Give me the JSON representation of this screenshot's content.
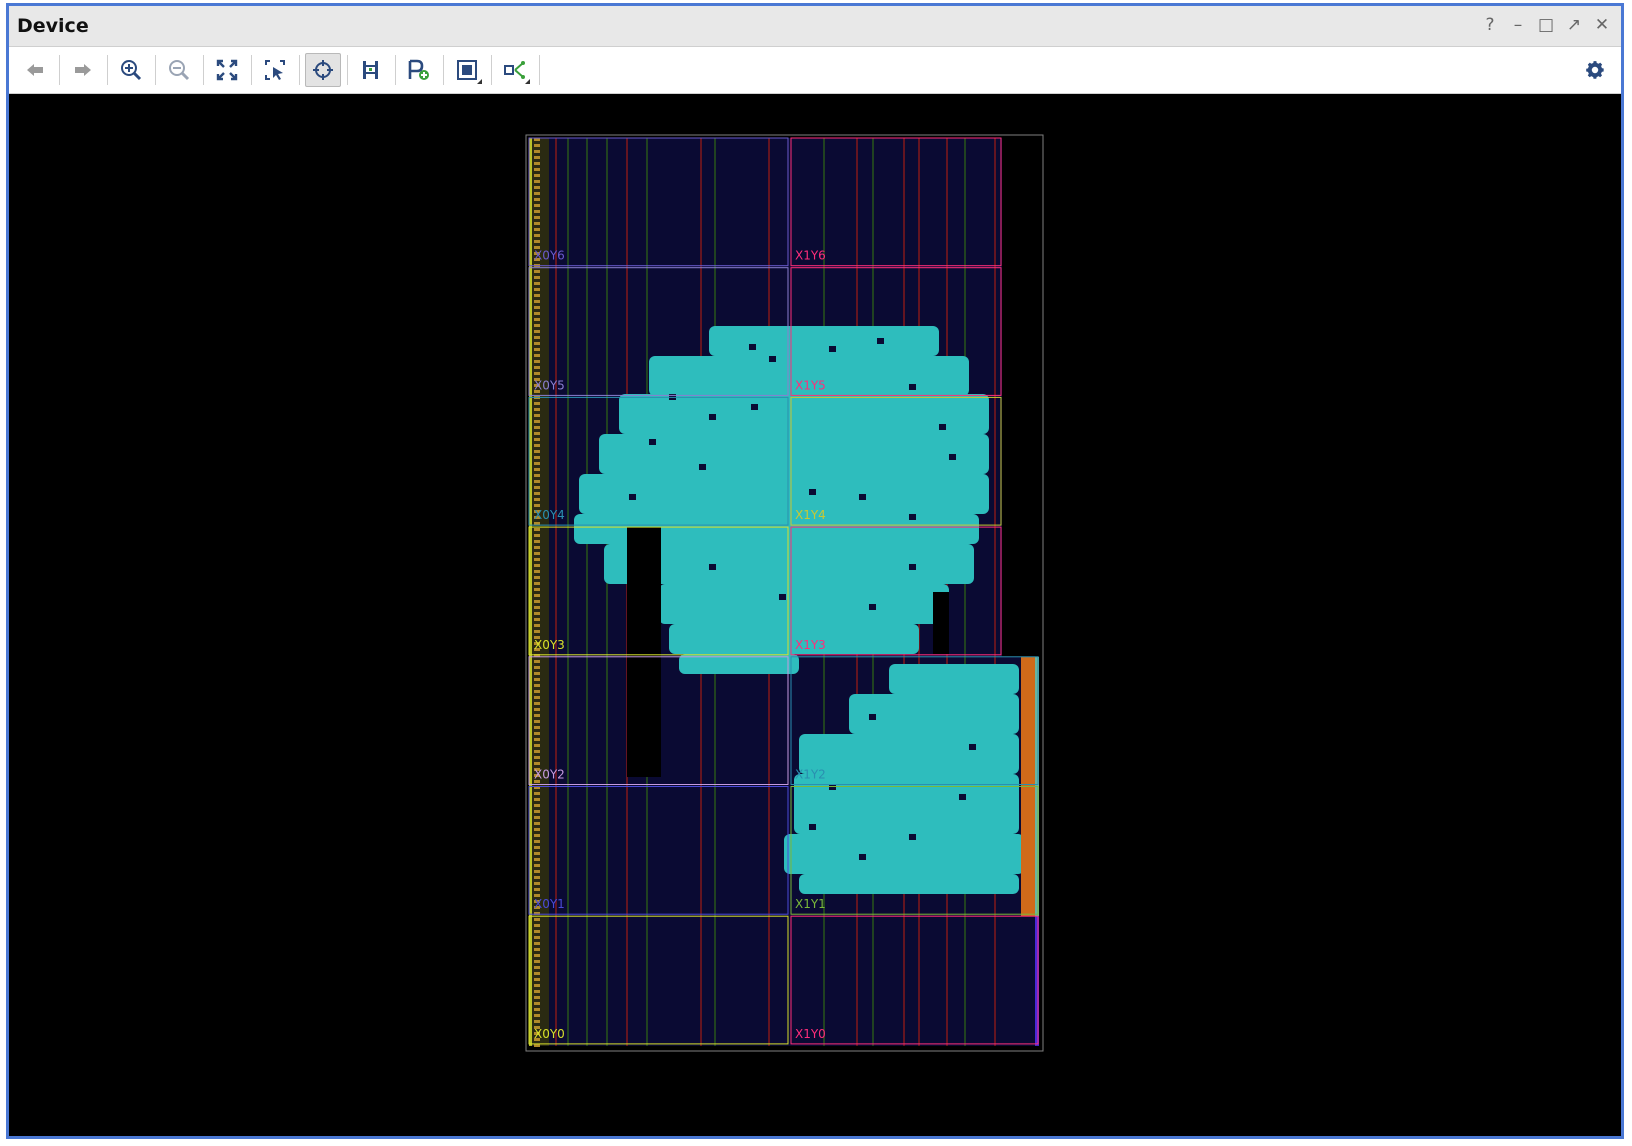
{
  "window": {
    "title": "Device",
    "controls": {
      "help": "?",
      "minimize": "–",
      "maximize": "□",
      "float": "↗",
      "close": "✕"
    }
  },
  "toolbar": {
    "buttons": [
      {
        "name": "back-button",
        "icon": "arrow-left-icon"
      },
      {
        "name": "forward-button",
        "icon": "arrow-right-icon"
      },
      {
        "name": "zoom-in-button",
        "icon": "zoom-in-icon"
      },
      {
        "name": "zoom-out-button",
        "icon": "zoom-out-icon"
      },
      {
        "name": "zoom-fit-button",
        "icon": "fit-icon"
      },
      {
        "name": "zoom-selection-button",
        "icon": "zoom-area-icon"
      },
      {
        "name": "autofit-selection-button",
        "icon": "crosshair-icon",
        "active": true
      },
      {
        "name": "show-routing-button",
        "icon": "routing-icon"
      },
      {
        "name": "create-pblock-button",
        "icon": "pblock-add-icon"
      },
      {
        "name": "site-view-button",
        "icon": "site-icon"
      },
      {
        "name": "connectivity-button",
        "icon": "connect-icon"
      }
    ],
    "settings_icon": "gear-icon"
  },
  "clock_regions": [
    {
      "label": "X0Y6",
      "color": "#6a5acd"
    },
    {
      "label": "X1Y6",
      "color": "#ff2d7a"
    },
    {
      "label": "X0Y5",
      "color": "#8a7fd0"
    },
    {
      "label": "X1Y5",
      "color": "#ff2d7a"
    },
    {
      "label": "X0Y4",
      "color": "#2a8fb0"
    },
    {
      "label": "X1Y4",
      "color": "#c8c832"
    },
    {
      "label": "X0Y3",
      "color": "#d7e02b"
    },
    {
      "label": "X1Y3",
      "color": "#ff2d7a"
    },
    {
      "label": "X0Y2",
      "color": "#c59be0"
    },
    {
      "label": "X1Y2",
      "color": "#2a8fb0"
    },
    {
      "label": "X0Y1",
      "color": "#4a4ad8"
    },
    {
      "label": "X1Y1",
      "color": "#7ab83a"
    },
    {
      "label": "X0Y0",
      "color": "#d7e02b"
    },
    {
      "label": "X1Y0",
      "color": "#ff2d7a"
    }
  ],
  "colors": {
    "background": "#000000",
    "fabric": "#0a0a33",
    "placement": "#2ebdbd",
    "accent": "#4a78d4"
  }
}
